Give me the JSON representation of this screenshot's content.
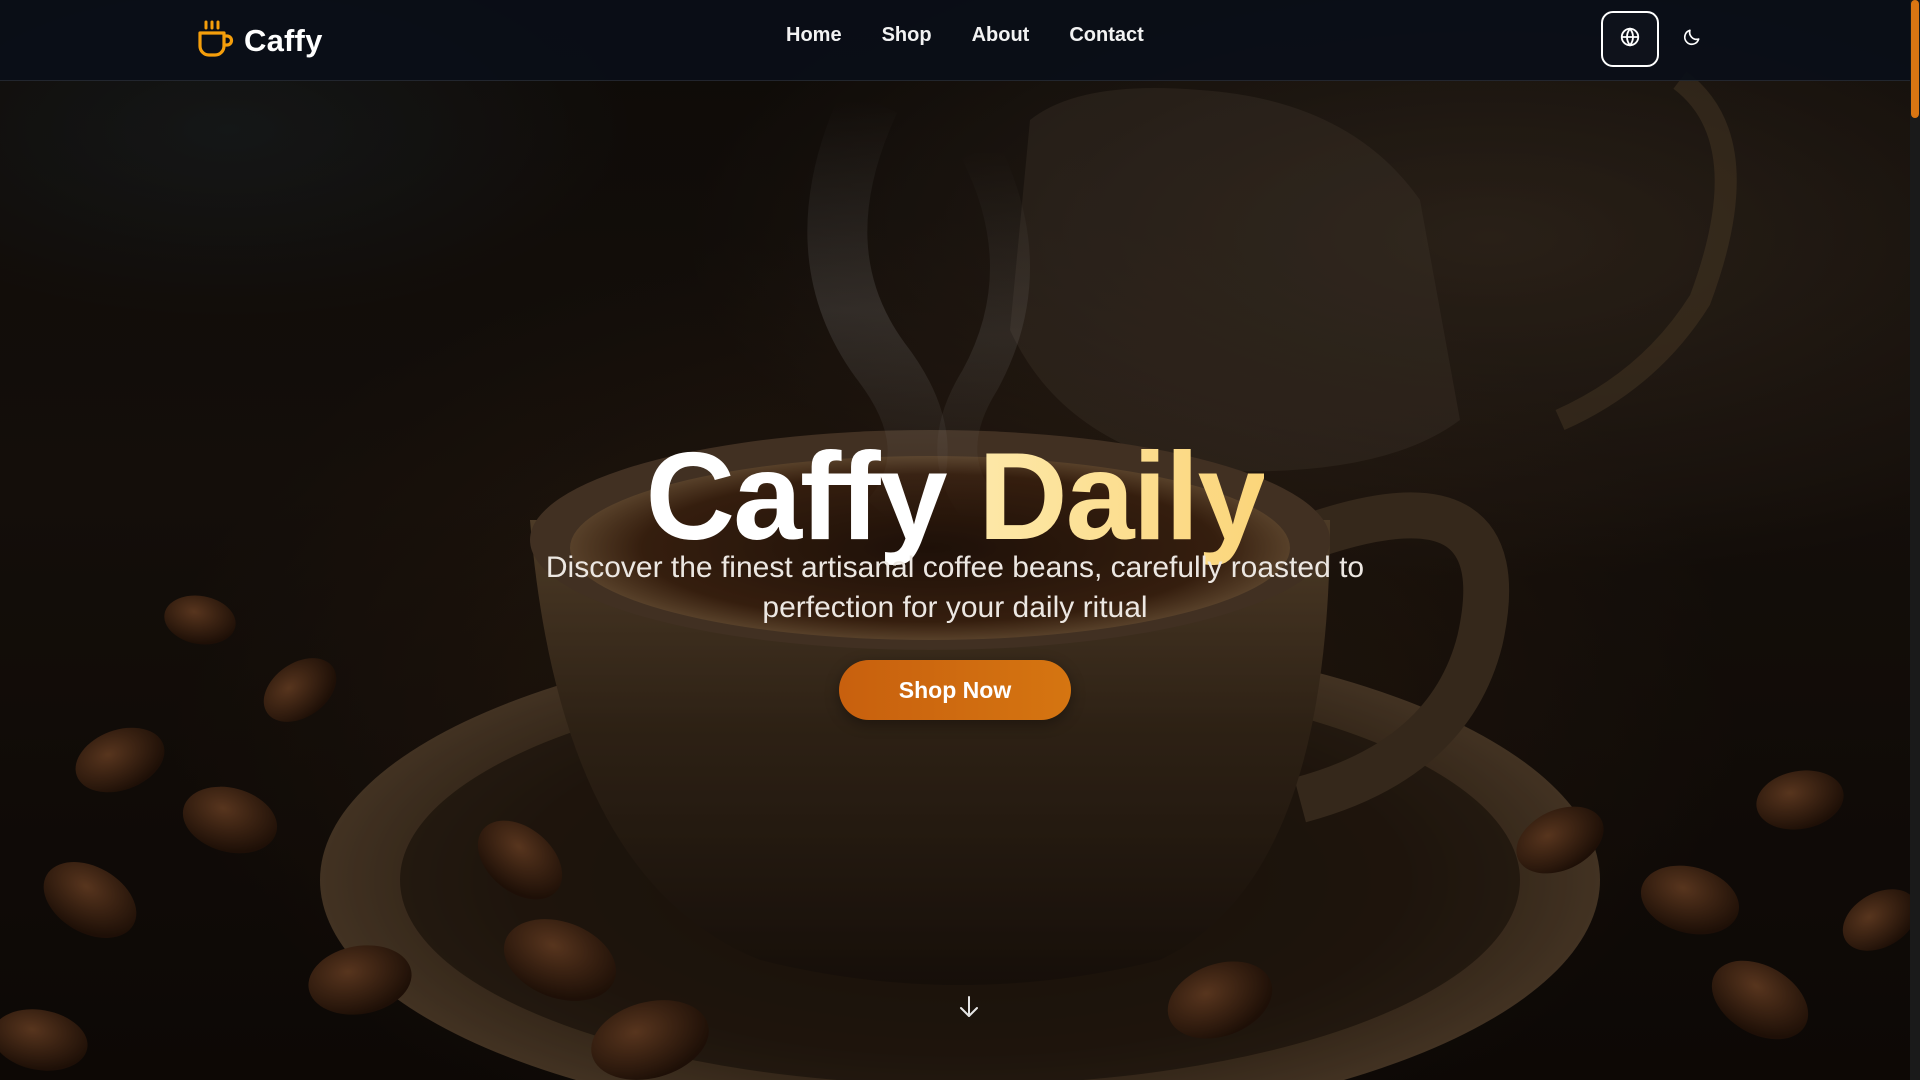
{
  "brand": {
    "name": "Caffy",
    "icon": "coffee-cup-icon",
    "accent": "#f59e0b"
  },
  "nav": {
    "links": [
      {
        "label": "Home"
      },
      {
        "label": "Shop"
      },
      {
        "label": "About"
      },
      {
        "label": "Contact"
      }
    ],
    "language_icon": "globe-icon",
    "theme_icon": "moon-icon"
  },
  "hero": {
    "title_word1": "Caffy",
    "title_word2": "Daily",
    "subtitle": "Discover the finest artisanal coffee beans, carefully roasted to perfection for your daily ritual",
    "cta_label": "Shop Now",
    "scroll_icon": "arrow-down-icon",
    "background_image": "coffee-cup-with-beans-photo"
  },
  "colors": {
    "navbar_bg": "#0a0e18",
    "cta_start": "#c8600e",
    "cta_end": "#d57511",
    "title_highlight": "#fde68a",
    "scrollbar_thumb": "#d97512"
  }
}
